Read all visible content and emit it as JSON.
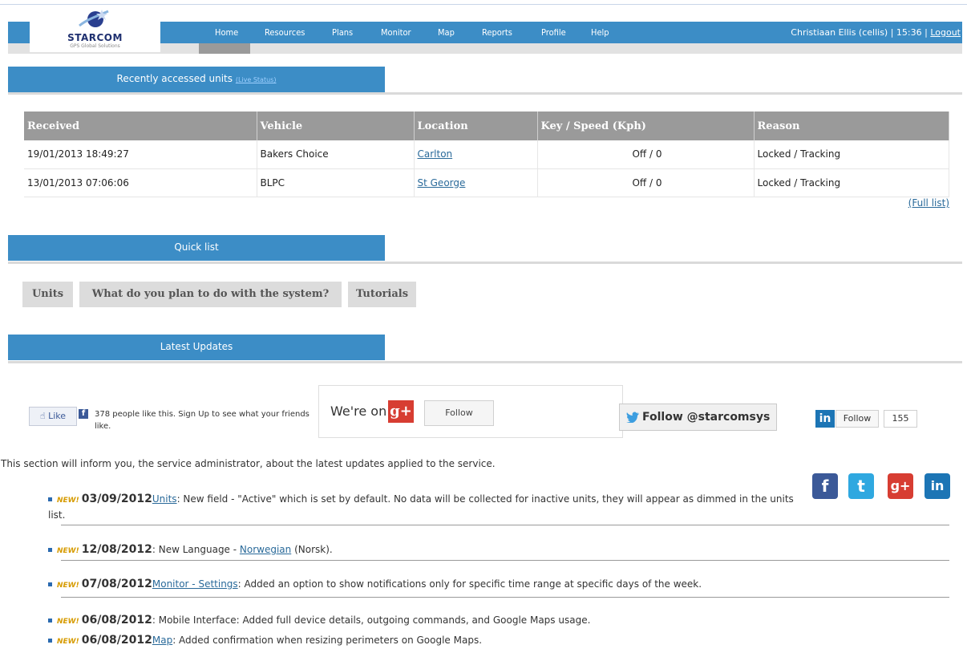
{
  "header": {
    "brand": "STARCOM",
    "tagline": "GPS Global Solutions",
    "nav": [
      "Home",
      "Resources",
      "Plans",
      "Monitor",
      "Map",
      "Reports",
      "Profile",
      "Help"
    ],
    "user_text": "Christiaan Ellis (cellis) | 15:36 |",
    "logout": "Logout"
  },
  "recent": {
    "title": "Recently accessed units",
    "live_status": "(Live Status)",
    "columns": [
      "Received",
      "Vehicle",
      "Location",
      "Key / Speed (Kph)",
      "Reason"
    ],
    "rows": [
      {
        "received": "19/01/2013 18:49:27",
        "vehicle": "Bakers Choice",
        "location": "Carlton",
        "key_speed": "Off / 0",
        "reason": "Locked / Tracking"
      },
      {
        "received": "13/01/2013 07:06:06",
        "vehicle": "BLPC",
        "location": "St George",
        "key_speed": "Off / 0",
        "reason": "Locked / Tracking"
      }
    ],
    "full_list": "(Full list)"
  },
  "quick": {
    "title": "Quick list",
    "tabs": [
      "Units",
      "What do you plan to do with the system?",
      "Tutorials"
    ]
  },
  "updates": {
    "title": "Latest Updates",
    "fb_like": "Like",
    "fb_text": "378 people like this. Sign Up to see what your friends like.",
    "gplus_label": "We're on",
    "gplus_follow": "Follow",
    "twitter": "Follow @starcomsys",
    "linkedin_follow": "Follow",
    "linkedin_count": "155",
    "intro": "This section will inform you, the service administrator, about the latest updates applied to the service.",
    "new_badge": "NEW!",
    "items": [
      {
        "date": "03/09/2012",
        "link": "Units",
        "text": ": New field - \"Active\" which is set by default. No data will be collected for inactive units, they will appear as dimmed in the units list."
      },
      {
        "date": "12/08/2012",
        "pre": ": New Language - ",
        "link": "Norwegian",
        "text": " (Norsk)."
      },
      {
        "date": "07/08/2012",
        "link": "Monitor - Settings",
        "text": ": Added an option to show notifications only for specific time range at specific days of the week."
      },
      {
        "date": "06/08/2012",
        "text": ": Mobile Interface: Added full device details, outgoing commands, and Google Maps usage."
      },
      {
        "date": "06/08/2012",
        "link": "Map",
        "text": ": Added confirmation when resizing perimeters on Google Maps."
      }
    ]
  },
  "colors": {
    "accent": "#3c8dc6",
    "header_gray": "#9a9a9a",
    "tab_gray": "#dcdcdc"
  }
}
